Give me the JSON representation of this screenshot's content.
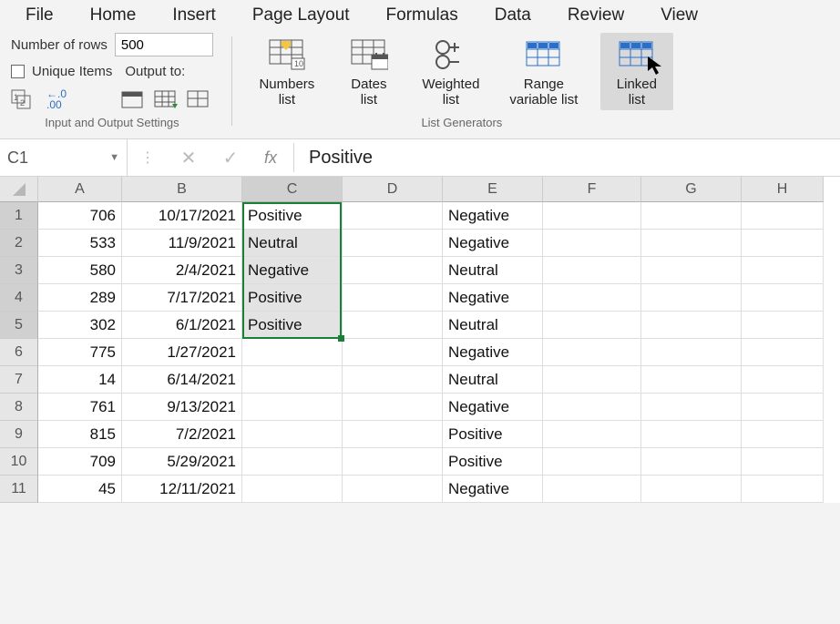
{
  "menu": [
    "File",
    "Home",
    "Insert",
    "Page Layout",
    "Formulas",
    "Data",
    "Review",
    "View"
  ],
  "ribbon": {
    "left": {
      "numrows_label": "Number of rows",
      "numrows_value": "500",
      "unique_label": "Unique Items",
      "output_label": "Output to:",
      "group_label": "Input and Output Settings"
    },
    "buttons": {
      "numbers": "Numbers\nlist",
      "dates": "Dates\nlist",
      "weighted": "Weighted\nlist",
      "range": "Range\nvariable list",
      "linked": "Linked\nlist"
    },
    "group2_label": "List Generators"
  },
  "formula_bar": {
    "namebox": "C1",
    "fx_symbol": "fx",
    "value": "Positive"
  },
  "sheet": {
    "col_headers": [
      "A",
      "B",
      "C",
      "D",
      "E",
      "F",
      "G",
      "H"
    ],
    "selected_col": "C",
    "selected_rows": [
      1,
      2,
      3,
      4,
      5
    ],
    "active_cell": {
      "row": 1,
      "col": "C"
    },
    "rows": [
      {
        "n": 1,
        "A": "706",
        "B": "10/17/2021",
        "C": "Positive",
        "E": "Negative"
      },
      {
        "n": 2,
        "A": "533",
        "B": "11/9/2021",
        "C": "Neutral",
        "E": "Negative"
      },
      {
        "n": 3,
        "A": "580",
        "B": "2/4/2021",
        "C": "Negative",
        "E": "Neutral"
      },
      {
        "n": 4,
        "A": "289",
        "B": "7/17/2021",
        "C": "Positive",
        "E": "Negative"
      },
      {
        "n": 5,
        "A": "302",
        "B": "6/1/2021",
        "C": "Positive",
        "E": "Neutral"
      },
      {
        "n": 6,
        "A": "775",
        "B": "1/27/2021",
        "C": "",
        "E": "Negative"
      },
      {
        "n": 7,
        "A": "14",
        "B": "6/14/2021",
        "C": "",
        "E": "Neutral"
      },
      {
        "n": 8,
        "A": "761",
        "B": "9/13/2021",
        "C": "",
        "E": "Negative"
      },
      {
        "n": 9,
        "A": "815",
        "B": "7/2/2021",
        "C": "",
        "E": "Positive"
      },
      {
        "n": 10,
        "A": "709",
        "B": "5/29/2021",
        "C": "",
        "E": "Positive"
      },
      {
        "n": 11,
        "A": "45",
        "B": "12/11/2021",
        "C": "",
        "E": "Negative"
      }
    ]
  }
}
